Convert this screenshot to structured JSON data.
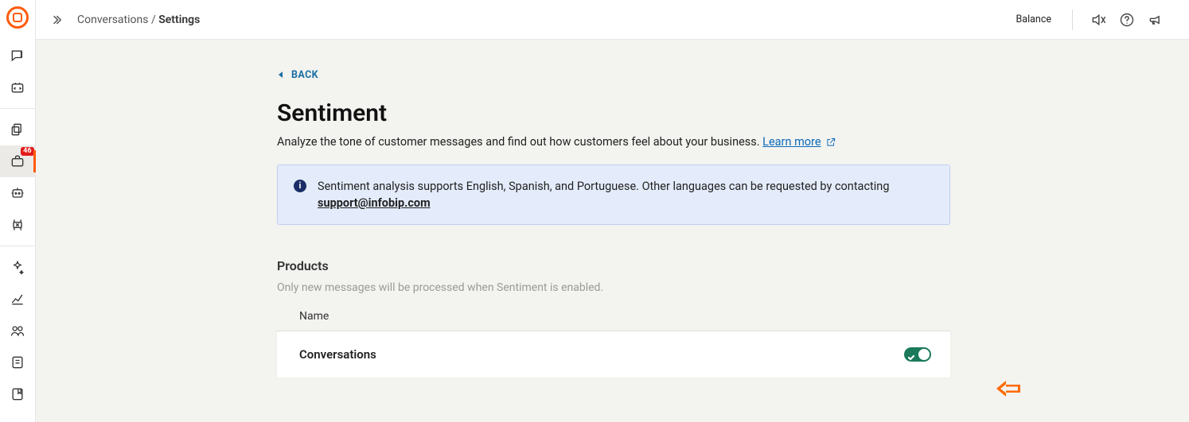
{
  "header": {
    "breadcrumb_parent": "Conversations",
    "breadcrumb_sep": " / ",
    "breadcrumb_current": "Settings",
    "balance_label": "Balance"
  },
  "sidebar": {
    "badge": "46"
  },
  "page": {
    "back_label": "BACK",
    "title": "Sentiment",
    "subtitle": "Analyze the tone of customer messages and find out how customers feel about your business.",
    "learn_more": "Learn more",
    "info_text": "Sentiment analysis supports English, Spanish, and Portuguese. Other languages can be requested by contacting ",
    "info_email": "support@infobip.com",
    "products_heading": "Products",
    "products_sub": "Only new messages will be processed when Sentiment is enabled.",
    "col_name": "Name",
    "rows": [
      {
        "name": "Conversations",
        "enabled": true
      }
    ]
  }
}
